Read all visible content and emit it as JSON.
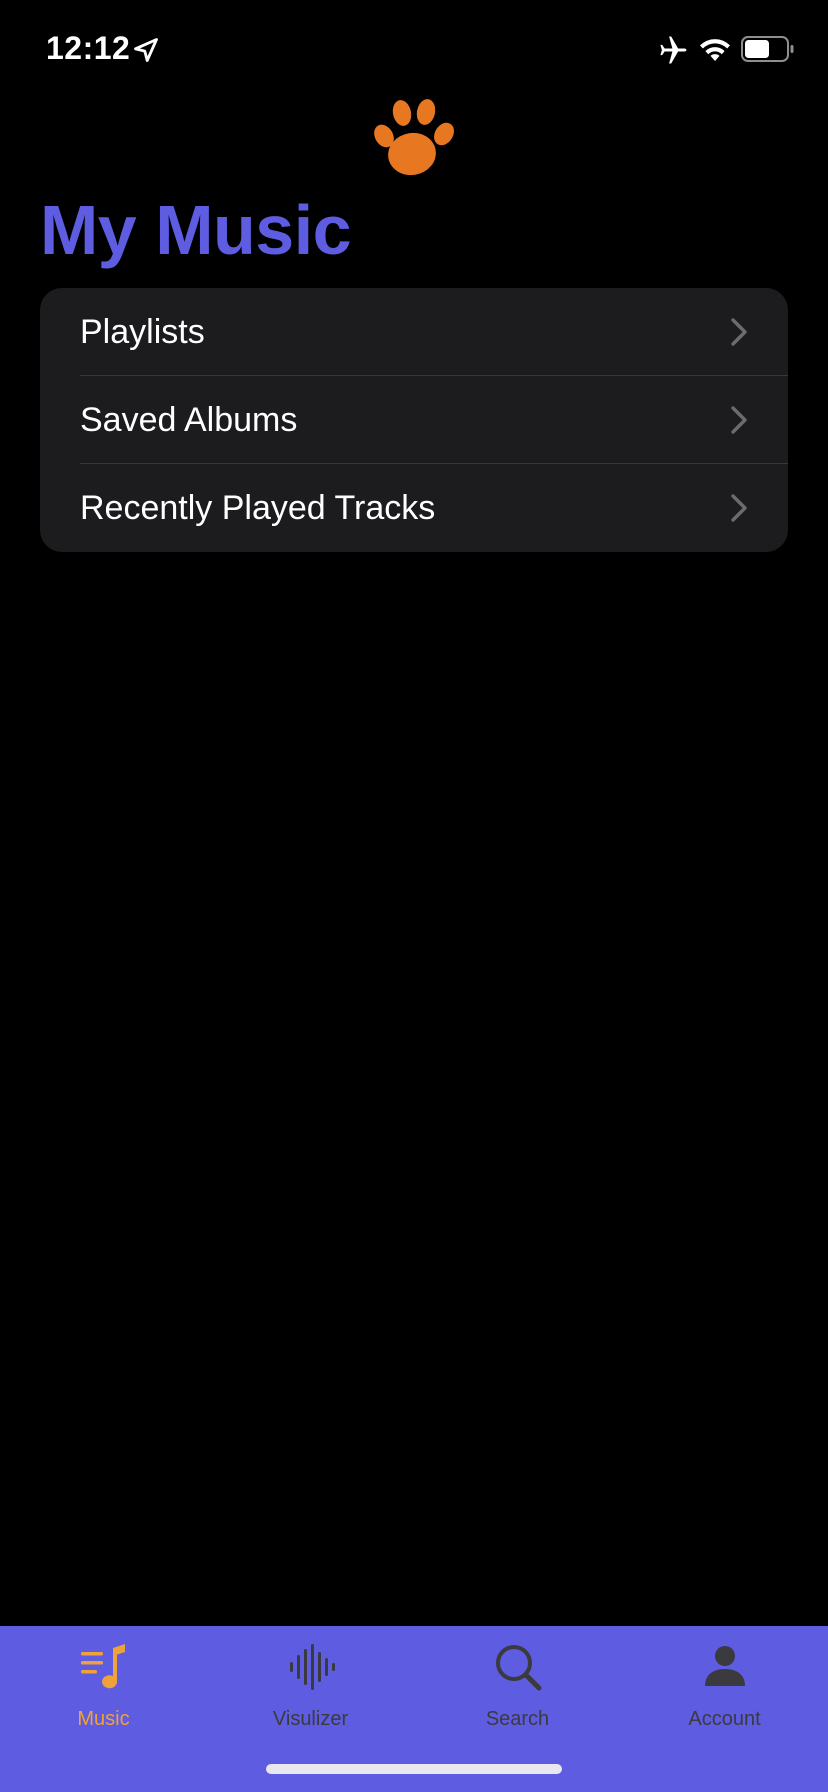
{
  "status_bar": {
    "time": "12:12"
  },
  "header": {
    "title": "My Music",
    "logo_icon": "paw-icon",
    "logo_color": "#e87722"
  },
  "menu": {
    "items": [
      {
        "label": "Playlists",
        "icon": "chevron-right-icon"
      },
      {
        "label": "Saved Albums",
        "icon": "chevron-right-icon"
      },
      {
        "label": "Recently Played Tracks",
        "icon": "chevron-right-icon"
      }
    ]
  },
  "tab_bar": {
    "tabs": [
      {
        "label": "Music",
        "icon": "music-list-icon",
        "active": true
      },
      {
        "label": "Visulizer",
        "icon": "waveform-icon",
        "active": false
      },
      {
        "label": "Search",
        "icon": "search-icon",
        "active": false
      },
      {
        "label": "Account",
        "icon": "person-icon",
        "active": false
      }
    ]
  },
  "colors": {
    "accent": "#5e5ce0",
    "active_tab": "#f0a23a",
    "inactive_tab": "#3a3a3f",
    "background": "#000000",
    "card": "#1c1c1e"
  }
}
